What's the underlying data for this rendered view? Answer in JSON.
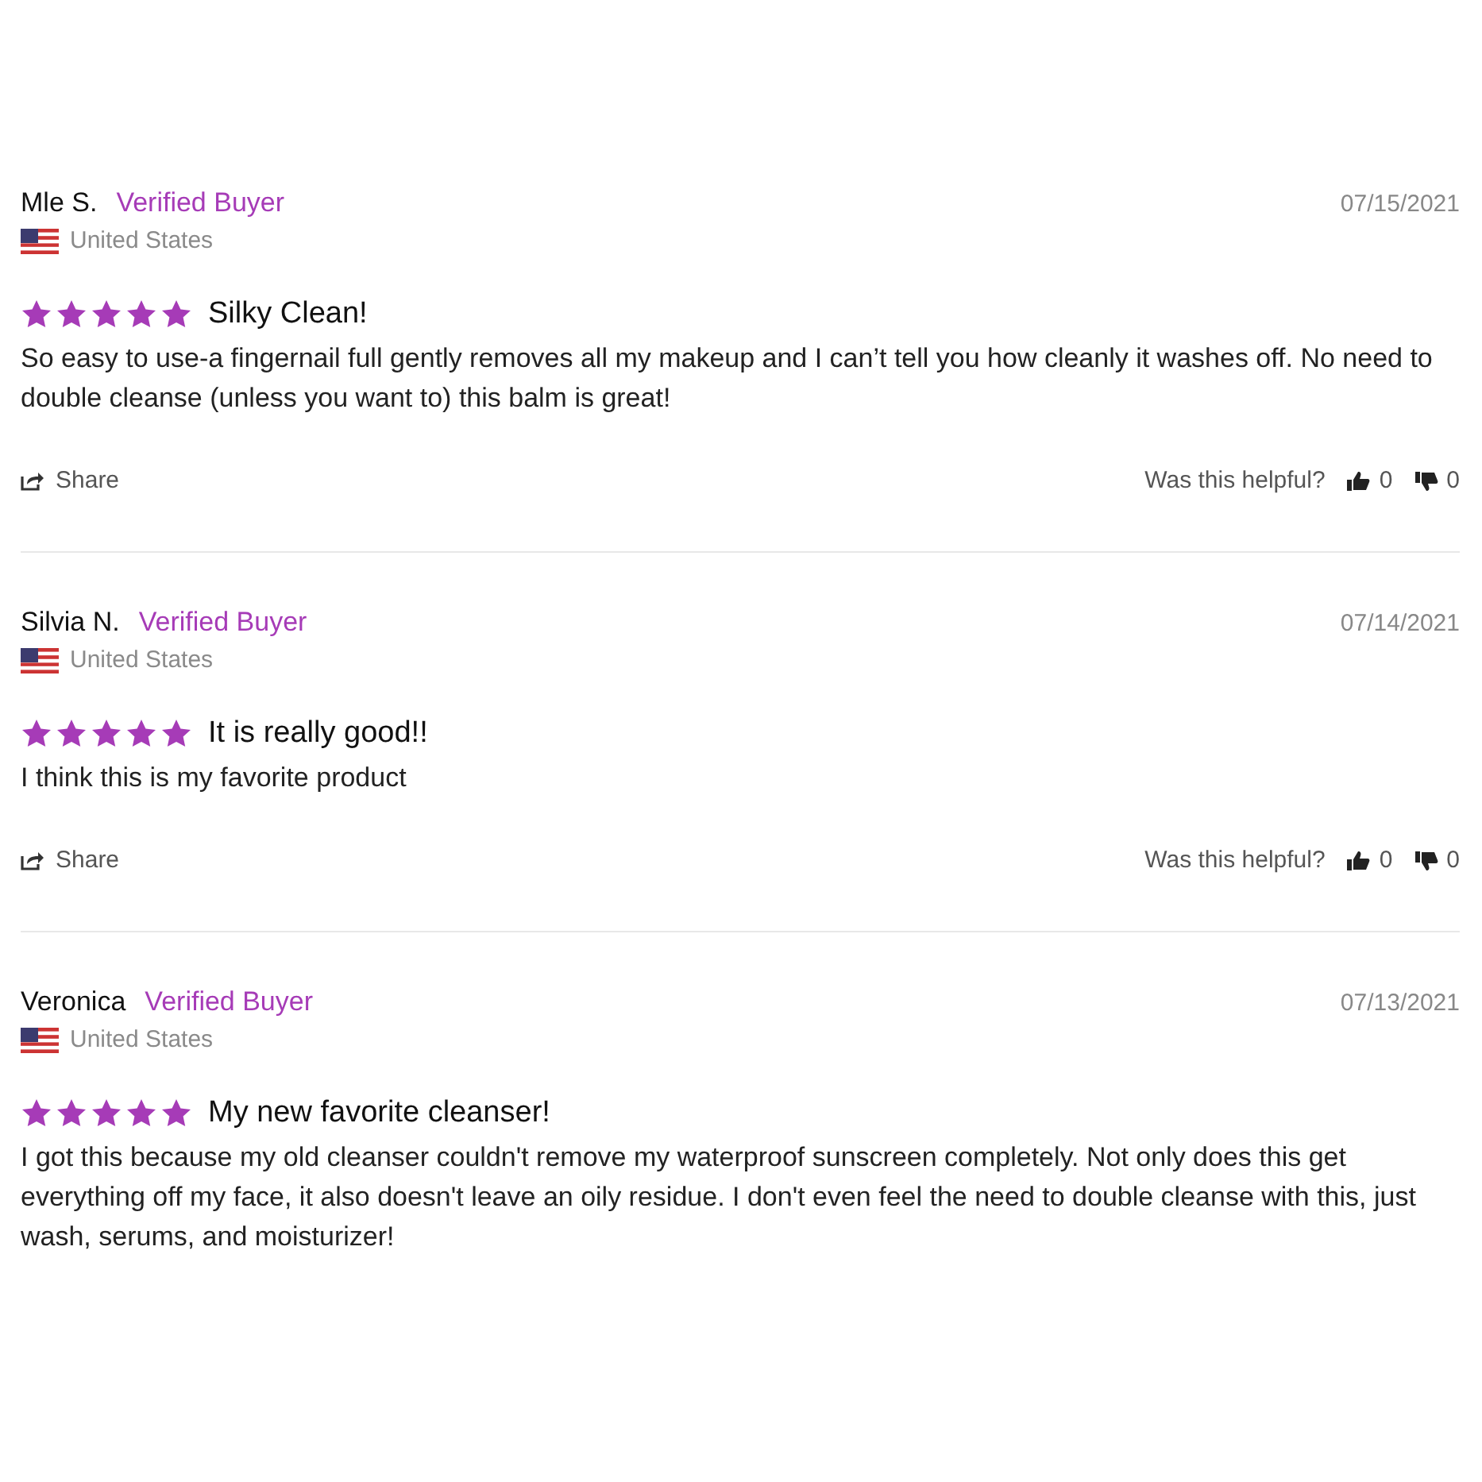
{
  "reviews": [
    {
      "name": "Mle S.",
      "badge": "Verified Buyer",
      "country": "United States",
      "date": "07/15/2021",
      "stars": 5,
      "title": "Silky Clean!",
      "body": "So easy to use-a fingernail full gently removes all my makeup and I can’t tell you how cleanly it washes off. No need to double cleanse (unless you want to) this balm is great!",
      "footer": {
        "share": "Share",
        "helpful": "Was this helpful?",
        "up": "0",
        "down": "0"
      }
    },
    {
      "name": "Silvia N.",
      "badge": "Verified Buyer",
      "country": "United States",
      "date": "07/14/2021",
      "stars": 5,
      "title": "It is really good!!",
      "body": "I think this is my favorite product",
      "footer": {
        "share": "Share",
        "helpful": "Was this helpful?",
        "up": "0",
        "down": "0"
      }
    },
    {
      "name": "Veronica",
      "badge": "Verified Buyer",
      "country": "United States",
      "date": "07/13/2021",
      "stars": 5,
      "title": "My new favorite cleanser!",
      "body": "I got this because my old cleanser couldn't remove my waterproof sunscreen completely. Not only does this get everything off my face, it also doesn't leave an oily residue. I don't even feel the need to double cleanse with this, just wash, serums, and moisturizer!"
    }
  ]
}
